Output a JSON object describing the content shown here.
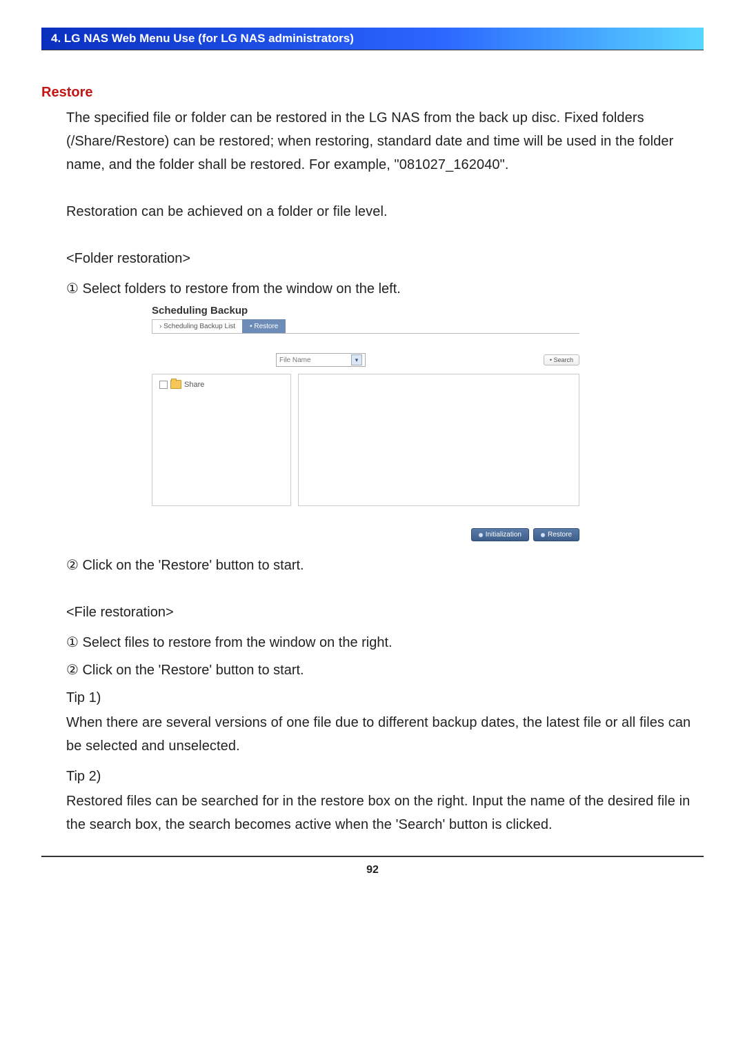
{
  "header": {
    "title": "4. LG NAS Web Menu Use (for LG NAS administrators)"
  },
  "restore": {
    "heading": "Restore",
    "intro": "The specified file or folder can be restored in the LG NAS from the back up disc. Fixed folders (/Share/Restore) can be restored; when restoring, standard date and time will be used in the folder name, and the folder shall be restored. For example, \"081027_162040\".",
    "scope_note": "Restoration can be achieved on a folder or file level.",
    "folder_heading": "<Folder restoration>",
    "folder_step1": "①  Select folders to restore from the window on the left.",
    "folder_step2": "②  Click on the 'Restore' button to start.",
    "file_heading": "<File restoration>",
    "file_step1": "①  Select files to restore from the window on the right.",
    "file_step2": "②  Click on the 'Restore' button to start.",
    "tip1_label": "Tip 1)",
    "tip1_text": "When there are several versions of one file due to different backup dates, the latest file or all files can be selected and unselected.",
    "tip2_label": "Tip 2)",
    "tip2_text": "Restored files can be searched for in the restore box on the right. Input the name of the desired file in the search box, the search becomes active when the 'Search' button is clicked."
  },
  "figure": {
    "title": "Scheduling Backup",
    "tabs": {
      "list": "›  Scheduling Backup List",
      "restore": "•  Restore"
    },
    "select_label": "File Name",
    "search_btn": "• Search",
    "tree_item": "Share",
    "actions": {
      "init": "Initialization",
      "restore": "Restore"
    }
  },
  "page_number": "92"
}
